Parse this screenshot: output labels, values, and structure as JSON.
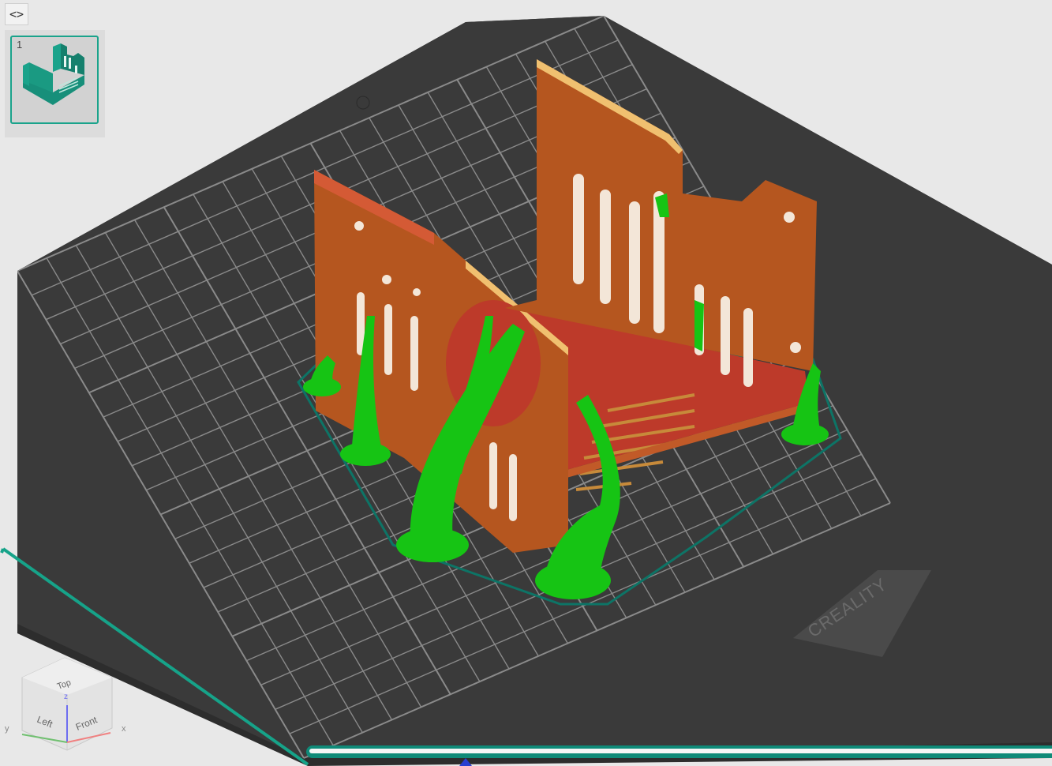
{
  "toolbar": {
    "collapse_icon": "chevron-left-right-icon",
    "collapse_label": "<>"
  },
  "plate_list": {
    "items": [
      {
        "index": "1",
        "thumbnail_icon": "model-thumbnail-icon"
      }
    ]
  },
  "build_plate": {
    "brand": "CREALITY"
  },
  "view_cube": {
    "top": "Top",
    "left": "Left",
    "front": "Front",
    "axes": {
      "x": "x",
      "y": "y",
      "z": "z"
    }
  },
  "colors": {
    "plate": "#3a3a3a",
    "grid": "#8a8a8a",
    "model_wall": "#b5561f",
    "model_floor": "#bd3a2a",
    "support": "#16c414",
    "skirt": "#0d7466",
    "accent": "#0f8a78"
  },
  "layer_slider": {
    "progress": 1.0
  }
}
